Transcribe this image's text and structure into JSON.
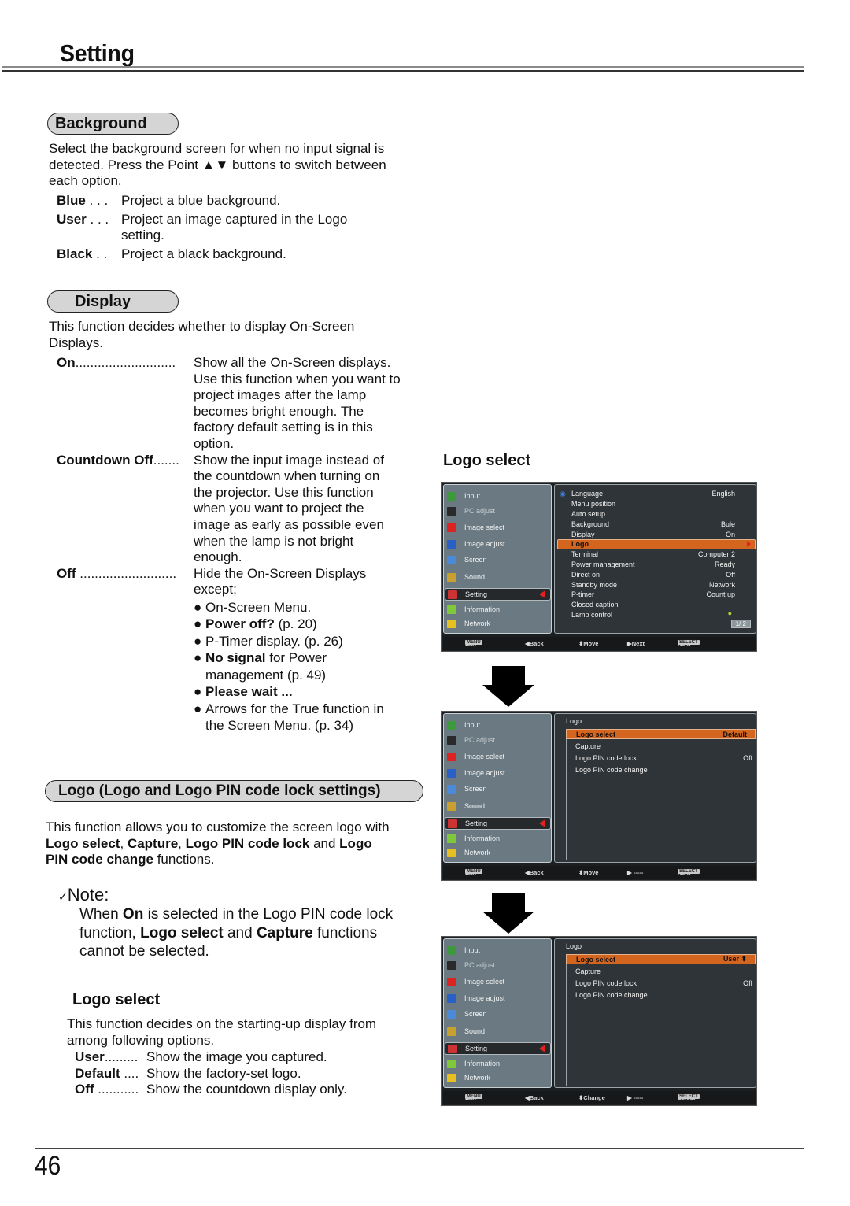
{
  "header": {
    "title": "Setting"
  },
  "background_section": {
    "heading": "Background",
    "intro": "Select the background screen for when no input signal is detected. Press the Point ▲▼ buttons to switch between each option.",
    "options": [
      {
        "term": "Blue",
        "dots": " . . . ",
        "desc": "Project a blue background."
      },
      {
        "term": "User",
        "dots": " . . . ",
        "desc": "Project an image captured in the Logo setting."
      },
      {
        "term": "Black",
        "dots": " . . ",
        "desc": "Project a black background."
      }
    ]
  },
  "display_section": {
    "heading": "Display",
    "intro": "This function decides whether to display On-Screen Displays.",
    "options": [
      {
        "term": "On",
        "dots": "...........................",
        "desc": "Show all the On-Screen displays. Use this function when you want to project images after the lamp becomes bright enough. The factory default setting is in this option."
      },
      {
        "term": "Countdown Off",
        "dots": ".......",
        "desc": "Show the input image instead of the countdown when turning on the projector. Use this function when you want to project the image as early as possible even when the lamp is not bright enough."
      },
      {
        "term": "Off",
        "dots": " ..........................",
        "desc": "Hide the On-Screen Displays except;"
      }
    ],
    "exceptions": [
      {
        "bold": "",
        "text": "On-Screen Menu."
      },
      {
        "bold": "Power off?",
        "text": " (p. 20)"
      },
      {
        "bold": "",
        "text": "P-Timer display. (p. 26)"
      },
      {
        "bold": "No signal",
        "text": " for Power management (p. 49)"
      },
      {
        "bold": "Please wait ...",
        "text": ""
      },
      {
        "bold": "",
        "text": "Arrows for the True function in the Screen Menu. (p. 34)"
      }
    ]
  },
  "logo_section": {
    "heading": "Logo (Logo and Logo PIN code lock settings)",
    "intro_parts": [
      "This function allows you to customize the screen logo with ",
      "Logo select",
      ", ",
      "Capture",
      ", ",
      "Logo PIN code lock",
      " and ",
      "Logo PIN code change",
      " functions."
    ],
    "note": {
      "check": "✓",
      "title": "Note:",
      "parts": [
        "When ",
        "On",
        " is selected in the Logo PIN code lock function, ",
        "Logo select",
        " and ",
        "Capture",
        " functions cannot be selected."
      ]
    },
    "logo_select": {
      "heading": "Logo select",
      "intro": "This function decides on the starting-up display from among following options.",
      "options": [
        {
          "term": "User",
          "dots": ".........",
          "desc": "Show the image you captured."
        },
        {
          "term": "Default",
          "dots": " ....",
          "desc": "Show the factory-set logo."
        },
        {
          "term": "Off",
          "dots": " ...........",
          "desc": "Show the countdown display only."
        }
      ]
    }
  },
  "figure": {
    "caption": "Logo select",
    "main_menu": [
      "Input",
      "PC adjust",
      "Image select",
      "Image adjust",
      "Screen",
      "Sound",
      "Setting",
      "Information",
      "Network"
    ],
    "screen1": {
      "items": [
        {
          "label": "Language",
          "value": "English"
        },
        {
          "label": "Menu position",
          "value": ""
        },
        {
          "label": "Auto setup",
          "value": ""
        },
        {
          "label": "Background",
          "value": "Bule"
        },
        {
          "label": "Display",
          "value": "On"
        },
        {
          "label": "Logo",
          "value": ""
        },
        {
          "label": "Terminal",
          "value": "Computer 2"
        },
        {
          "label": "Power management",
          "value": "Ready"
        },
        {
          "label": "Direct on",
          "value": "Off"
        },
        {
          "label": "Standby mode",
          "value": "Network"
        },
        {
          "label": "P-timer",
          "value": "Count up"
        },
        {
          "label": "Closed caption",
          "value": ""
        },
        {
          "label": "Lamp control",
          "value": ""
        }
      ],
      "page": "1/ 2",
      "bar": {
        "menu_key": "MENU",
        "exit": "Exit",
        "back": "◀Back",
        "move": "⬍Move",
        "next": "▶Next",
        "select_key": "SELECT",
        "select": "Next"
      }
    },
    "screen2": {
      "title": "Logo",
      "items": [
        {
          "label": "Logo select",
          "value": "Default"
        },
        {
          "label": "Capture",
          "value": ""
        },
        {
          "label": "Logo PIN code lock",
          "value": "Off"
        },
        {
          "label": "Logo PIN code change",
          "value": ""
        }
      ],
      "bar": {
        "menu_key": "MENU",
        "exit": "Exit",
        "back": "◀Back",
        "move": "⬍Move",
        "next": "▶ -----",
        "select_key": "SELECT",
        "select": "Next"
      }
    },
    "screen3": {
      "title": "Logo",
      "items": [
        {
          "label": "Logo select",
          "value": "User ⬍"
        },
        {
          "label": "Capture",
          "value": ""
        },
        {
          "label": "Logo PIN code lock",
          "value": "Off"
        },
        {
          "label": "Logo PIN code change",
          "value": ""
        }
      ],
      "bar": {
        "menu_key": "MENU",
        "exit": "Exit",
        "back": "◀Back",
        "move": "⬍Change",
        "next": "▶ -----",
        "select_key": "SELECT",
        "select": "Select"
      }
    },
    "colors": {
      "highlight": "#d3651f",
      "panel_left": "#6b7a82",
      "panel_right": "#2f3438",
      "pointer": "#e3211e"
    }
  },
  "footer": {
    "page_number": "46"
  }
}
